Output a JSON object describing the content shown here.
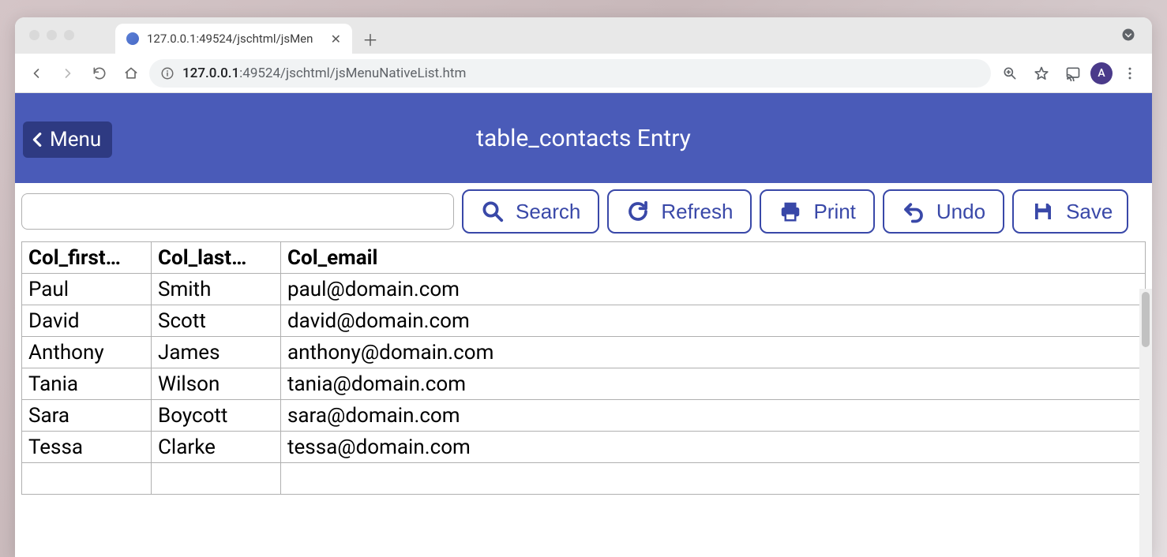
{
  "browser": {
    "tab_title": "127.0.0.1:49524/jschtml/jsMen",
    "url_host": "127.0.0.1",
    "url_rest": ":49524/jschtml/jsMenuNativeList.htm",
    "profile_initial": "A"
  },
  "header": {
    "menu_label": "Menu",
    "title": "table_contacts Entry"
  },
  "toolbar": {
    "search_value": "",
    "search_label": "Search",
    "refresh_label": "Refresh",
    "print_label": "Print",
    "undo_label": "Undo",
    "save_label": "Save"
  },
  "table": {
    "columns": [
      "Col_first…",
      "Col_last…",
      "Col_email"
    ],
    "rows": [
      {
        "first": "Paul",
        "last": "Smith",
        "email": "paul@domain.com"
      },
      {
        "first": "David",
        "last": "Scott",
        "email": "david@domain.com"
      },
      {
        "first": "Anthony",
        "last": "James",
        "email": "anthony@domain.com"
      },
      {
        "first": "Tania",
        "last": "Wilson",
        "email": "tania@domain.com"
      },
      {
        "first": "Sara",
        "last": "Boycott",
        "email": "sara@domain.com"
      },
      {
        "first": "Tessa",
        "last": "Clarke",
        "email": "tessa@domain.com"
      },
      {
        "first": "",
        "last": "",
        "email": ""
      }
    ]
  }
}
